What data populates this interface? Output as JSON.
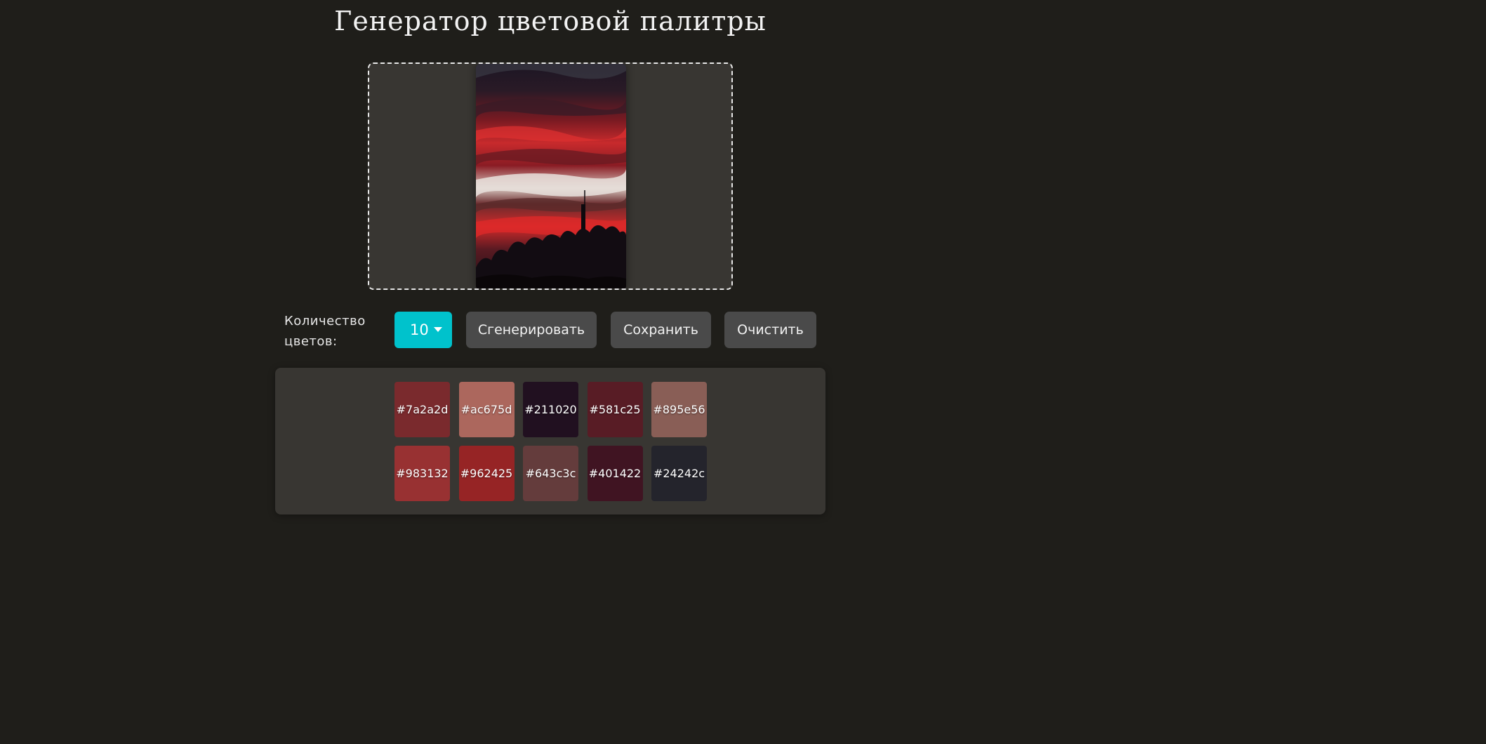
{
  "title": "Генератор цветовой палитры",
  "controls": {
    "count_label": "Количество цветов:",
    "count_value": "10",
    "generate_label": "Сгенерировать",
    "save_label": "Сохранить",
    "clear_label": "Очистить"
  },
  "colors": {
    "page_bg": "#1f1e1a",
    "panel_bg": "#383632",
    "accent": "#00c2cc",
    "button_bg": "#4a4a4a"
  },
  "palette": [
    {
      "hex": "#7a2a2d"
    },
    {
      "hex": "#ac675d"
    },
    {
      "hex": "#211020"
    },
    {
      "hex": "#581c25"
    },
    {
      "hex": "#895e56"
    },
    {
      "hex": "#983132"
    },
    {
      "hex": "#962425"
    },
    {
      "hex": "#643c3c"
    },
    {
      "hex": "#401422"
    },
    {
      "hex": "#24242c"
    }
  ]
}
